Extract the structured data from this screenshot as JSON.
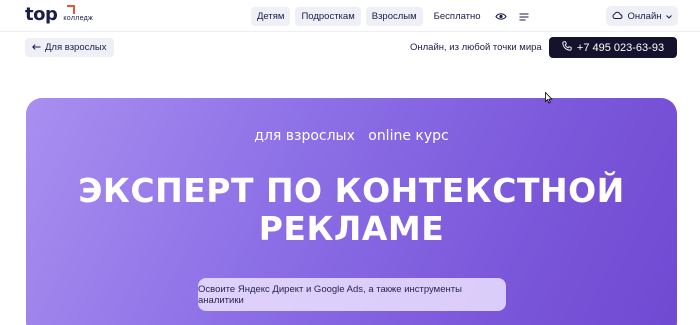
{
  "header": {
    "logo_word": "top",
    "logo_sub": "колледж",
    "nav": [
      "Детям",
      "Подросткам",
      "Взрослым",
      "Бесплатно"
    ],
    "online_label": "Онлайн"
  },
  "subbar": {
    "back_label": "Для взрослых",
    "tagline": "Онлайн, из любой точки мира",
    "phone": "+7 495 023-63-93"
  },
  "hero": {
    "tags": "для взрослых   online курс",
    "title_line1": "ЭКСПЕРТ ПО КОНТЕКСТНОЙ",
    "title_line2": "РЕКЛАМЕ",
    "subtitle": "Освоите Яндекс Директ и Google Ads, а также инструменты аналитики"
  },
  "colors": {
    "brand_dark": "#1b1d4d",
    "accent": "#e8543d",
    "hero_start": "#a98ff0",
    "hero_end": "#7049d2",
    "phone_bg": "#15122e"
  },
  "icons": [
    "eye-icon",
    "menu-icon",
    "cloud-icon",
    "chevron-down-icon",
    "arrow-left-icon",
    "phone-icon"
  ]
}
